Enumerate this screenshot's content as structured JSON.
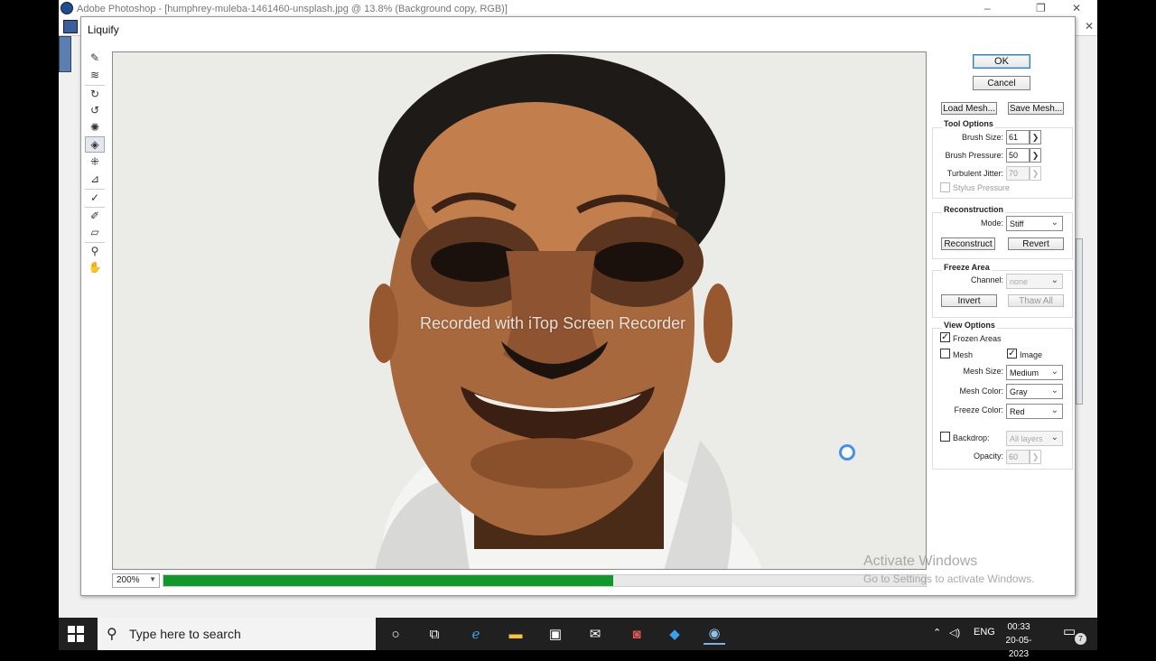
{
  "app": {
    "title": "Adobe Photoshop - [humphrey-muleba-1461460-unsplash.jpg @ 13.8% (Background copy, RGB)]"
  },
  "dialog": {
    "title": "Liquify",
    "ok_label": "OK",
    "cancel_label": "Cancel",
    "load_mesh_label": "Load Mesh...",
    "save_mesh_label": "Save Mesh...",
    "zoom_value": "200%",
    "progress": 0.59,
    "tool_options": {
      "title": "Tool Options",
      "brush_size_label": "Brush Size:",
      "brush_size_value": "61",
      "brush_pressure_label": "Brush Pressure:",
      "brush_pressure_value": "50",
      "turbulent_jitter_label": "Turbulent Jitter:",
      "turbulent_jitter_value": "70",
      "stylus_pressure_label": "Stylus Pressure",
      "stylus_pressure_checked": false
    },
    "reconstruction": {
      "title": "Reconstruction",
      "mode_label": "Mode:",
      "mode_value": "Stiff",
      "reconstruct_label": "Reconstruct",
      "revert_label": "Revert"
    },
    "freeze_area": {
      "title": "Freeze Area",
      "channel_label": "Channel:",
      "channel_value": "none",
      "invert_label": "Invert",
      "thaw_all_label": "Thaw All"
    },
    "view_options": {
      "title": "View Options",
      "frozen_areas_label": "Frozen Areas",
      "frozen_areas_checked": true,
      "mesh_label": "Mesh",
      "mesh_checked": false,
      "image_label": "Image",
      "image_checked": true,
      "mesh_size_label": "Mesh Size:",
      "mesh_size_value": "Medium",
      "mesh_color_label": "Mesh Color:",
      "mesh_color_value": "Gray",
      "freeze_color_label": "Freeze Color:",
      "freeze_color_value": "Red",
      "backdrop_label": "Backdrop:",
      "backdrop_checked": false,
      "backdrop_value": "All layers",
      "opacity_label": "Opacity:",
      "opacity_value": "60"
    },
    "tools": [
      "warp-tool-icon",
      "turbulence-tool-icon",
      "twirl-clockwise-tool-icon",
      "twirl-counterclockwise-tool-icon",
      "pucker-tool-icon",
      "bloat-tool-icon",
      "shift-pixels-tool-icon",
      "reflection-tool-icon",
      "reconstruct-tool-icon",
      "freeze-tool-icon",
      "thaw-tool-icon",
      "zoom-tool-icon",
      "hand-tool-icon"
    ],
    "active_tool": "bloat-tool-icon"
  },
  "overlay": {
    "recorder_watermark": "Recorded with iTop Screen Recorder",
    "activate_title": "Activate Windows",
    "activate_subtitle": "Go to Settings to activate Windows."
  },
  "taskbar": {
    "search_placeholder": "Type here to search",
    "language": "ENG",
    "time": "00:33",
    "date": "20-05-2023",
    "notification_count": "7"
  },
  "colors": {
    "progress_fill": "#12982a",
    "taskbar_bg": "#202020",
    "accent": "#3c7fb1"
  }
}
